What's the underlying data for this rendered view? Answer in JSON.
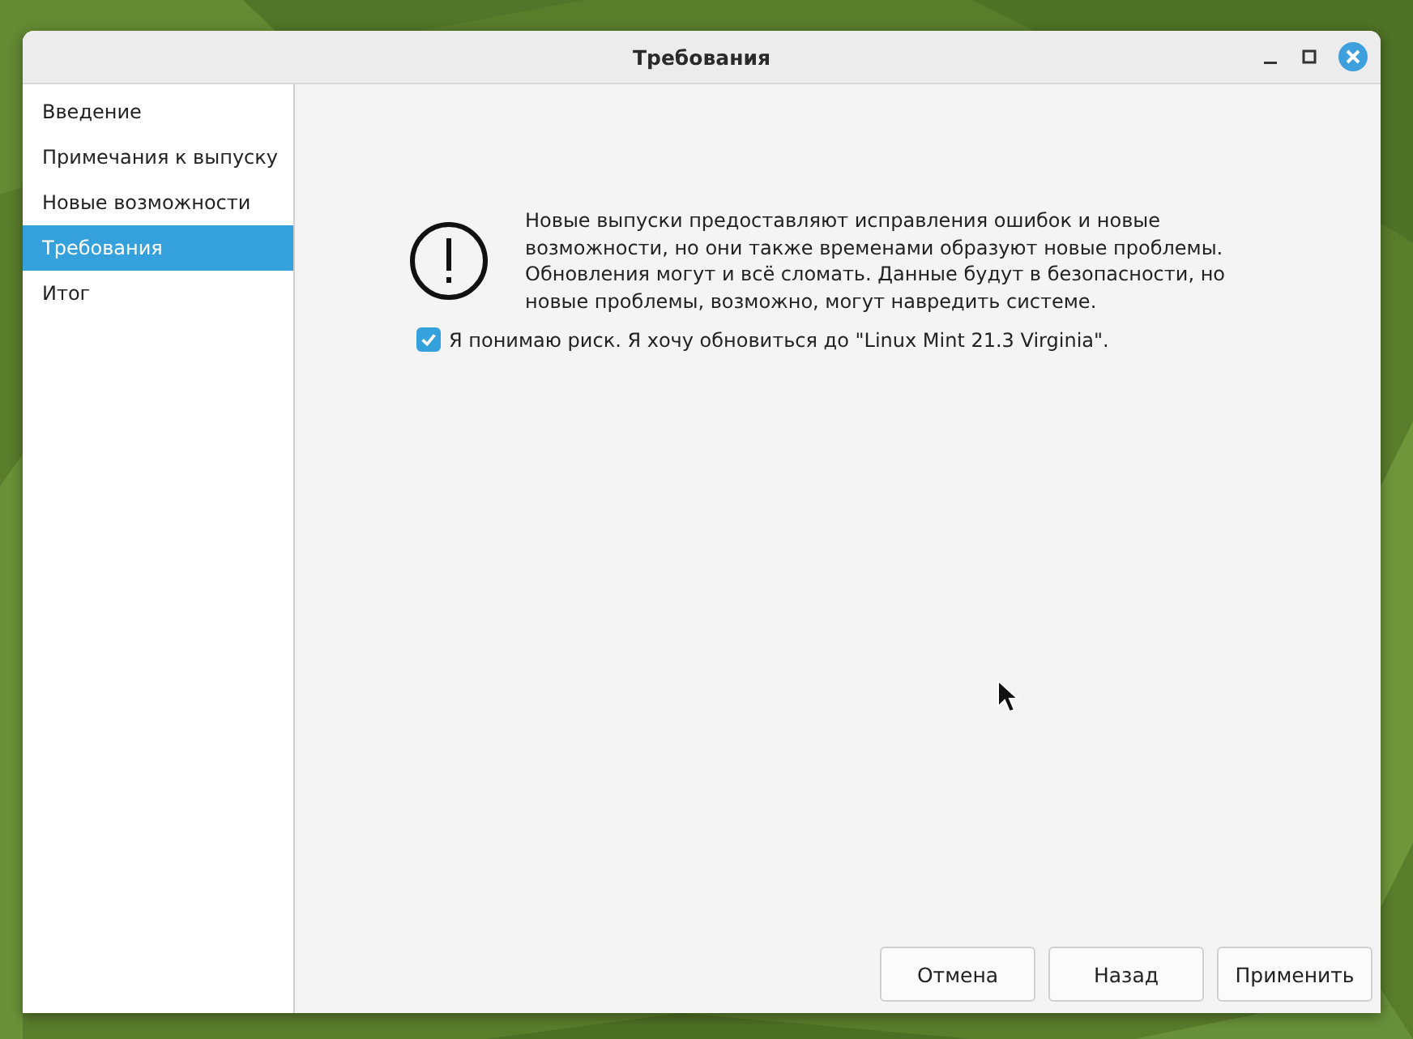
{
  "window": {
    "title": "Требования"
  },
  "sidebar": {
    "items": [
      {
        "label": "Введение",
        "selected": false
      },
      {
        "label": "Примечания к выпуску",
        "selected": false
      },
      {
        "label": "Новые возможности",
        "selected": false
      },
      {
        "label": "Требования",
        "selected": true
      },
      {
        "label": "Итог",
        "selected": false
      }
    ]
  },
  "message": "Новые выпуски предоставляют исправления ошибок и новые возможности, но они также временами образуют новые проблемы. Обновления могут и всё сломать. Данные будут в безопасности, но новые проблемы, возможно, могут навредить системе.",
  "confirm": {
    "label": "Я понимаю риск. Я хочу обновиться до \"Linux Mint 21.3 Virginia\".",
    "checked": true
  },
  "buttons": [
    "Отмена",
    "Назад",
    "Применить"
  ]
}
